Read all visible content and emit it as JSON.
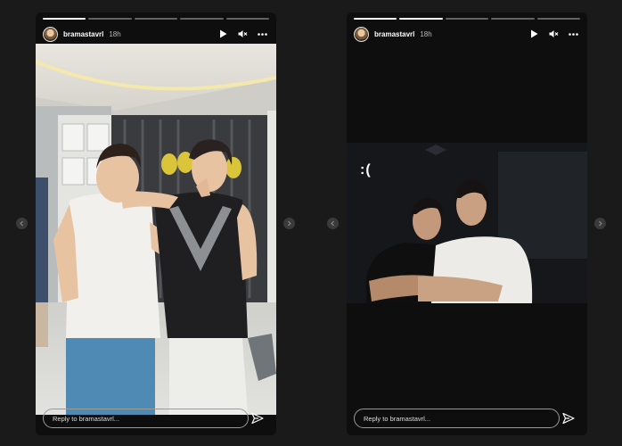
{
  "stories": [
    {
      "username": "bramastavrl",
      "time": "18h",
      "progress_segments": [
        1,
        0,
        0,
        0,
        0
      ],
      "reply_placeholder": "Reply to bramastavrl..."
    },
    {
      "username": "bramastavrl",
      "time": "18h",
      "progress_segments": [
        1,
        1,
        0,
        0,
        0
      ],
      "caption": ":(",
      "reply_placeholder": "Reply to bramastavrl..."
    }
  ],
  "icons": {
    "play": "play-icon",
    "mute": "speaker-muted-icon",
    "more": "more-options-icon",
    "send": "send-icon",
    "prev": "chevron-left-icon",
    "next": "chevron-right-icon"
  },
  "colors": {
    "background": "#1a1a1a",
    "story_bg": "#0e0e0e",
    "balloon_gold": "#d9c43a"
  }
}
